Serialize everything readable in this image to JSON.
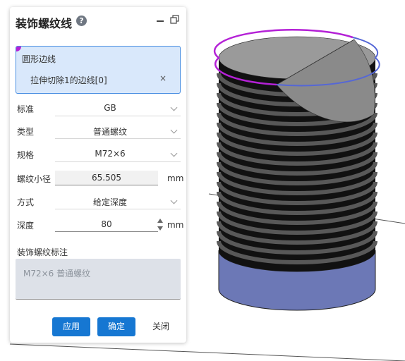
{
  "dialog": {
    "title": "装饰螺纹线",
    "help": "?",
    "selection": {
      "title": "圆形边线",
      "item": "拉伸切除1的边线[0]",
      "remove": "×"
    },
    "fields": {
      "standard": {
        "label": "标准",
        "value": "GB"
      },
      "type": {
        "label": "类型",
        "value": "普通螺纹"
      },
      "spec": {
        "label": "规格",
        "value": "M72×6"
      },
      "minor_diameter": {
        "label": "螺纹小径",
        "value": "65.505",
        "unit": "mm"
      },
      "method": {
        "label": "方式",
        "value": "给定深度"
      },
      "depth": {
        "label": "深度",
        "value": "80",
        "unit": "mm"
      }
    },
    "annotation": {
      "label": "装饰螺纹标注",
      "value": "M72×6 普通螺纹"
    },
    "buttons": {
      "apply": "应用",
      "ok": "确定",
      "close": "关闭"
    }
  },
  "colors": {
    "primary": "#1677d2",
    "selection_bg": "#d9e8fb",
    "selected_edge": "#b421d6",
    "cylinder_base": "#6c78b6",
    "thread_dark": "#111111",
    "thread_light": "#555555",
    "top_face": "#999999"
  },
  "icons": {
    "help": "question-circle-icon",
    "minimize": "minimize-icon",
    "restore": "restore-window-icon",
    "dropdown": "chevron-down-icon",
    "spinner": "up-down-spinner-icon"
  }
}
